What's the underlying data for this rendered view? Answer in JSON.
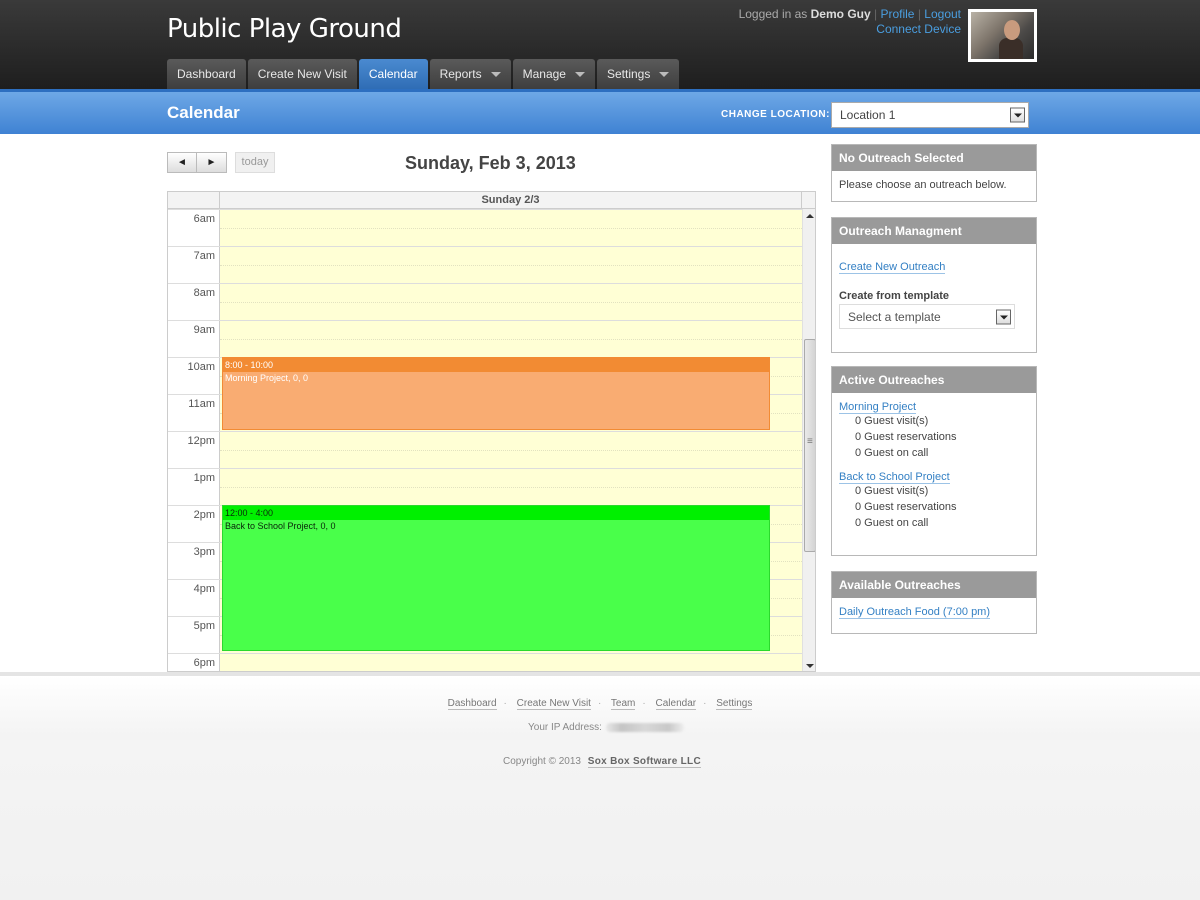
{
  "app": {
    "title": "Public Play Ground"
  },
  "user": {
    "logged_in_prefix": "Logged in as",
    "name": "Demo Guy",
    "profile_link": "Profile",
    "logout_link": "Logout",
    "connect_device_link": "Connect Device"
  },
  "nav": {
    "tabs": [
      {
        "label": "Dashboard",
        "active": false,
        "has_menu": false
      },
      {
        "label": "Create New Visit",
        "active": false,
        "has_menu": false
      },
      {
        "label": "Calendar",
        "active": true,
        "has_menu": false
      },
      {
        "label": "Reports",
        "active": false,
        "has_menu": true
      },
      {
        "label": "Manage",
        "active": false,
        "has_menu": true
      },
      {
        "label": "Settings",
        "active": false,
        "has_menu": true
      }
    ]
  },
  "page_bar": {
    "title": "Calendar",
    "change_location_label": "CHANGE LOCATION:",
    "location_selected": "Location 1"
  },
  "calendar": {
    "prev_icon": "◄",
    "next_icon": "►",
    "today_label": "today",
    "date_title": "Sunday, Feb 3, 2013",
    "day_header": "Sunday 2/3",
    "hours": [
      "6am",
      "7am",
      "8am",
      "9am",
      "10am",
      "11am",
      "12pm",
      "1pm",
      "2pm",
      "3pm",
      "4pm",
      "5pm",
      "6pm"
    ],
    "events": [
      {
        "time": "8:00 - 10:00",
        "title": "Morning Project, 0, 0",
        "color": "#f9ac72",
        "header_color": "#f28b33"
      },
      {
        "time": "12:00 - 4:00",
        "title": "Back to School Project, 0, 0",
        "color": "#49ff4a",
        "header_color": "#00f000"
      }
    ]
  },
  "sidebar": {
    "no_outreach": {
      "heading": "No Outreach Selected",
      "text": "Please choose an outreach below."
    },
    "management": {
      "heading": "Outreach Managment",
      "create_link": "Create New Outreach",
      "template_label": "Create from template",
      "template_placeholder": "Select a template"
    },
    "active": {
      "heading": "Active Outreaches",
      "items": [
        {
          "name": "Morning Project",
          "visits": "0 Guest visit(s)",
          "reservations": "0 Guest reservations",
          "on_call": "0 Guest on call"
        },
        {
          "name": "Back to School Project",
          "visits": "0 Guest visit(s)",
          "reservations": "0 Guest reservations",
          "on_call": "0 Guest on call"
        }
      ]
    },
    "available": {
      "heading": "Available Outreaches",
      "items": [
        {
          "name": "Daily Outreach Food (7:00 pm)"
        }
      ]
    }
  },
  "footer": {
    "links": [
      "Dashboard",
      "Create New Visit",
      "Team",
      "Calendar",
      "Settings"
    ],
    "ip_label": "Your IP Address:",
    "copyright": "Copyright © 2013",
    "company": "Sox Box Software LLC"
  },
  "colors": {
    "header_bg": "#2a2a2a",
    "accent_blue": "#3f82d3",
    "calendar_day_bg": "#ffffd5",
    "panel_head": "#9a9a9a"
  }
}
